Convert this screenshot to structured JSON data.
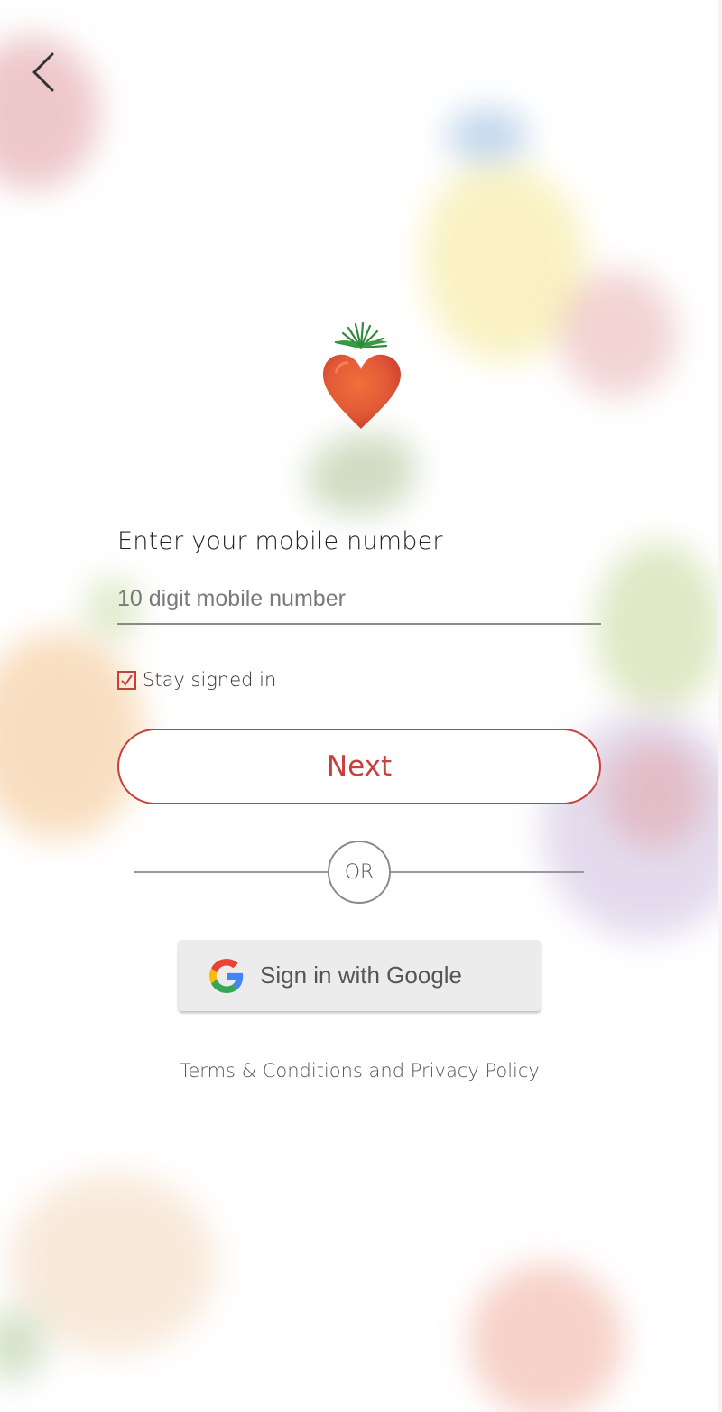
{
  "form": {
    "label": "Enter your mobile number",
    "phone_placeholder": "10 digit mobile number",
    "phone_value": "",
    "stay_signed_in_label": "Stay signed in",
    "stay_signed_in_checked": true,
    "next_label": "Next"
  },
  "divider": {
    "or_label": "OR"
  },
  "google": {
    "label": "Sign in with Google",
    "icon": "google-g-icon"
  },
  "footer": {
    "terms_label": "Terms & Conditions",
    "and_label": "and",
    "privacy_label": "Privacy Policy"
  },
  "icons": {
    "back": "chevron-left-icon",
    "logo": "strawberry-heart-logo",
    "checkbox": "checkmark-icon"
  },
  "colors": {
    "accent": "#c7403a",
    "text": "#333333",
    "google_button_bg": "#ececec"
  }
}
